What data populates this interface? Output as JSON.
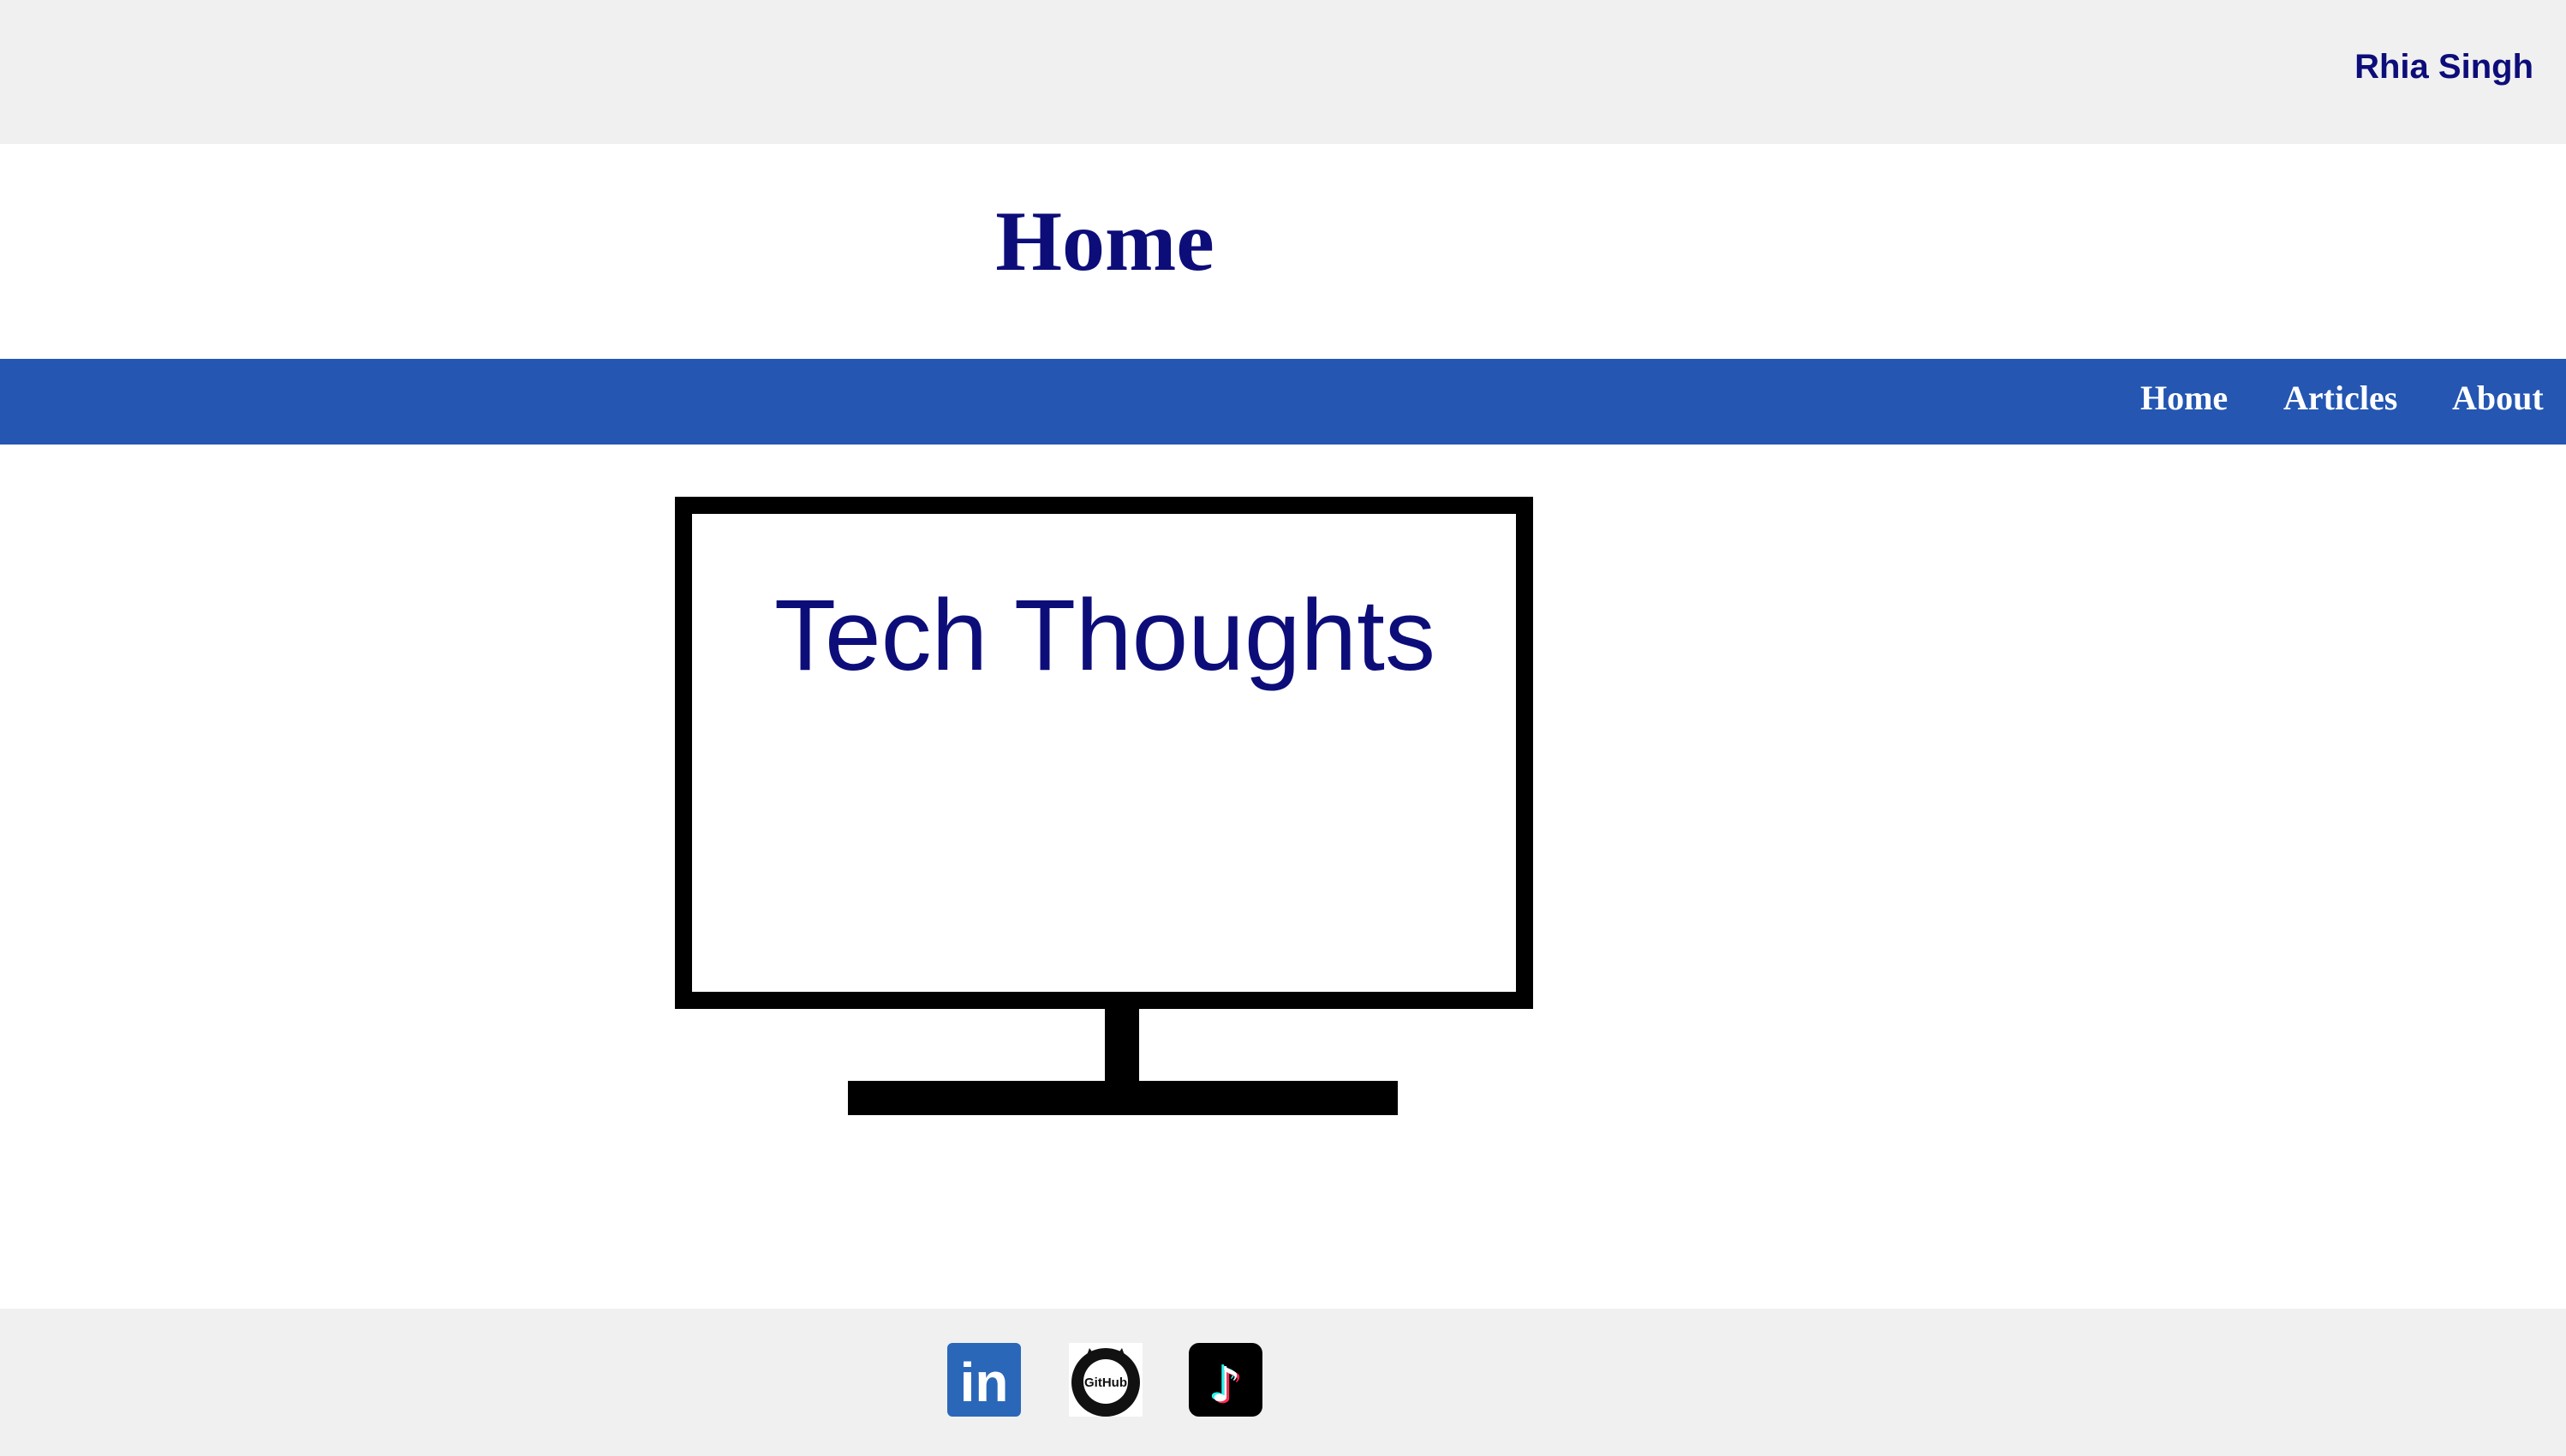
{
  "header": {
    "author_name": "Rhia Singh"
  },
  "page": {
    "title": "Home"
  },
  "nav": {
    "items": [
      {
        "label": "Home"
      },
      {
        "label": "Articles"
      },
      {
        "label": "About"
      }
    ]
  },
  "hero": {
    "title": "Tech Thoughts",
    "icon": "monitor-icon"
  },
  "footer": {
    "social_links": [
      {
        "name": "LinkedIn",
        "icon": "linkedin-icon",
        "glyph": "in"
      },
      {
        "name": "GitHub",
        "icon": "github-icon",
        "glyph": "GitHub"
      },
      {
        "name": "TikTok",
        "icon": "tiktok-icon",
        "glyph": "♪"
      }
    ]
  },
  "colors": {
    "header_bg": "#f0f0f0",
    "title_text": "#0d0d7a",
    "nav_bg": "#2456b2",
    "nav_text": "#ffffff",
    "linkedin_blue": "#2a67b9",
    "tiktok_cyan": "#25f4ee",
    "tiktok_red": "#fe2c55"
  }
}
